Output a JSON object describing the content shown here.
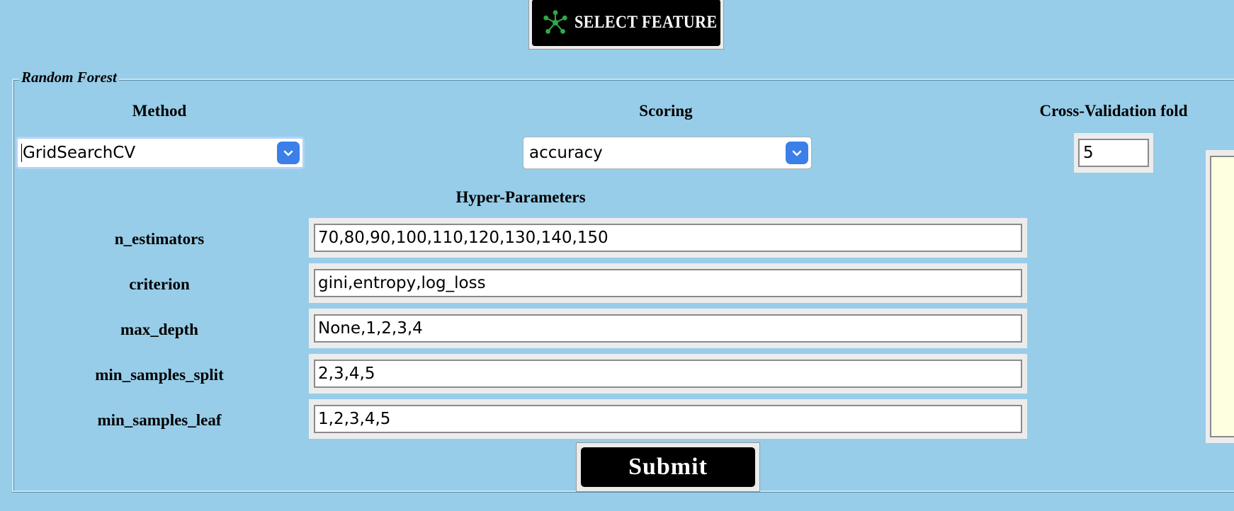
{
  "header": {
    "feature_button_label": "SELECT FEATURE",
    "feature_icon": "molecule-icon"
  },
  "panel": {
    "legend": "Random Forest",
    "method": {
      "label": "Method",
      "selected": "GridSearchCV"
    },
    "scoring": {
      "label": "Scoring",
      "selected": "accuracy"
    },
    "cv_fold": {
      "label": "Cross-Validation fold",
      "value": "5"
    },
    "hyper_parameters": {
      "title": "Hyper-Parameters",
      "rows": [
        {
          "label": "n_estimators",
          "value": "70,80,90,100,110,120,130,140,150"
        },
        {
          "label": "criterion",
          "value": "gini,entropy,log_loss"
        },
        {
          "label": "max_depth",
          "value": "None,1,2,3,4"
        },
        {
          "label": "min_samples_split",
          "value": "2,3,4,5"
        },
        {
          "label": "min_samples_leaf",
          "value": "1,2,3,4,5"
        }
      ]
    },
    "submit_label": "Submit"
  },
  "colors": {
    "background": "#97cde8",
    "button_bg": "#000000",
    "caret_blue": "#3b7fe8",
    "output_bg": "#fefee0",
    "icon_green": "#2fa84a"
  }
}
